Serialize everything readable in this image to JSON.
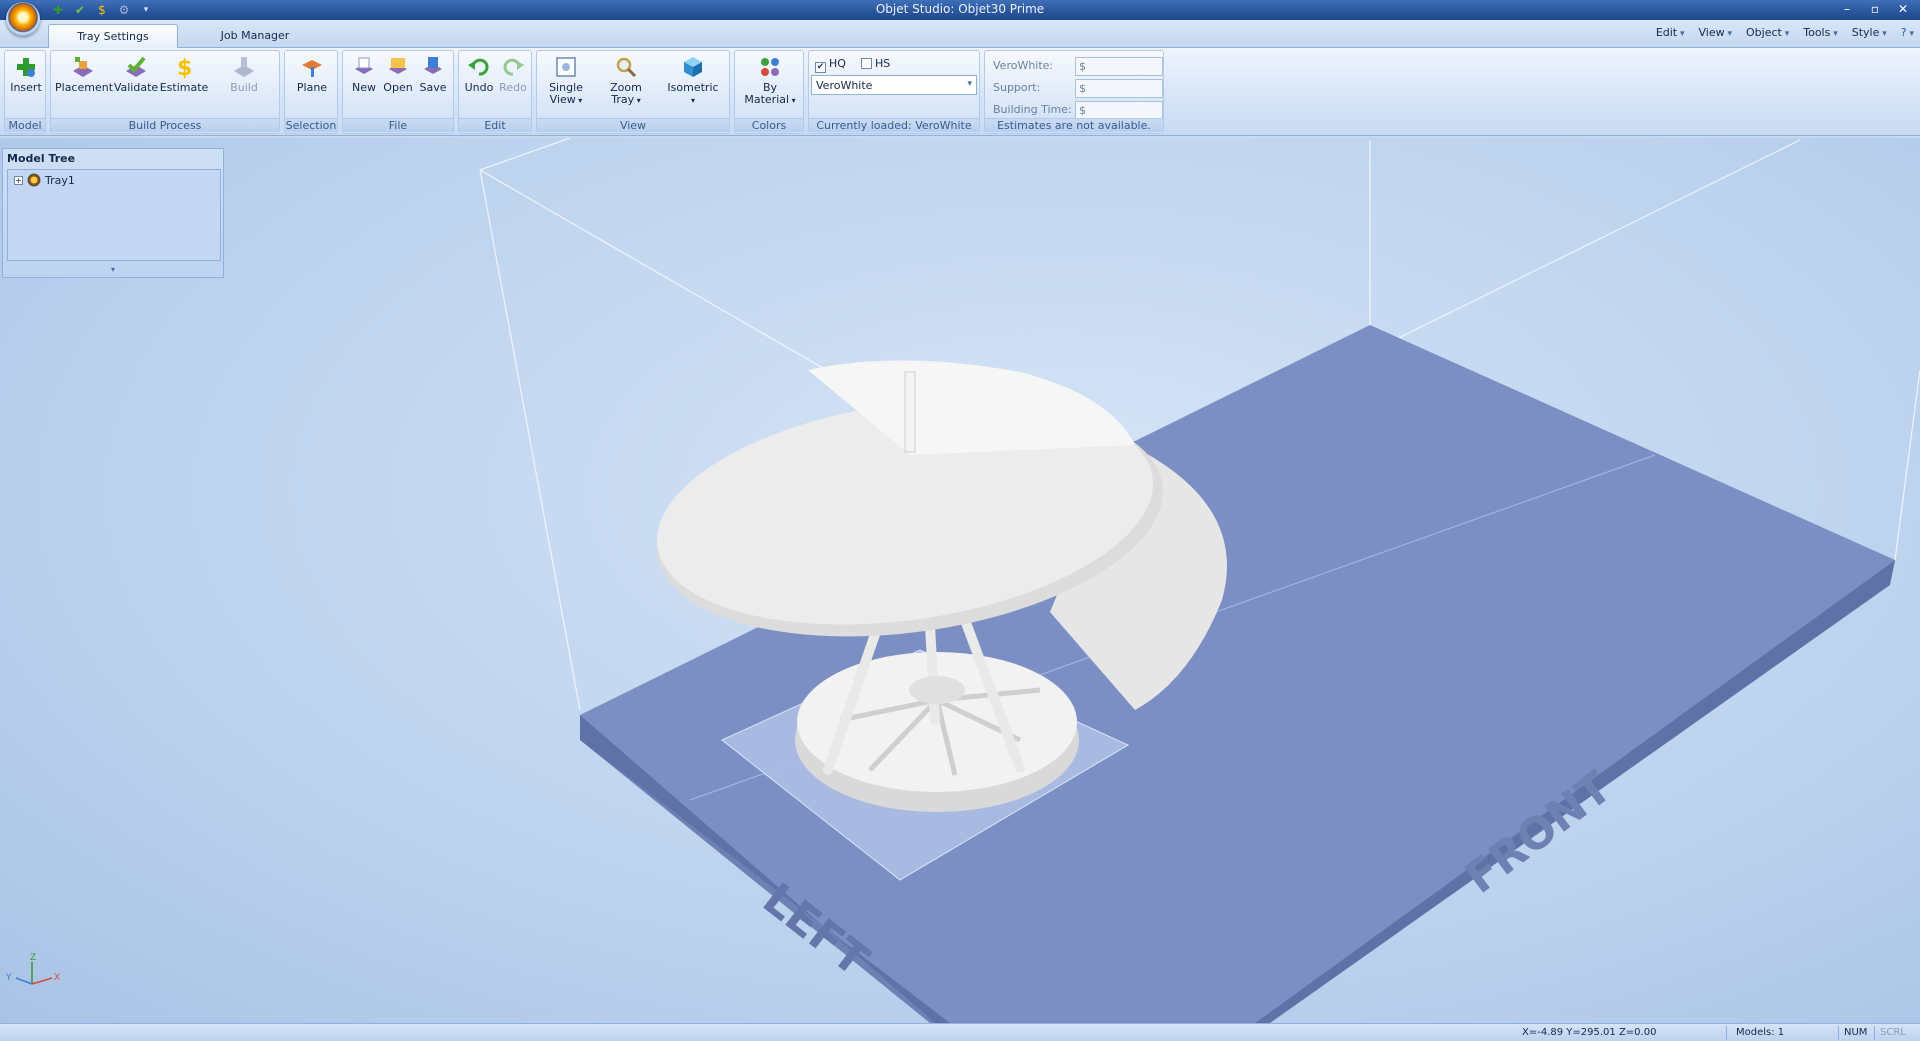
{
  "window": {
    "title": "Objet Studio: Objet30 Prime"
  },
  "tabs": [
    {
      "label": "Tray Settings",
      "active": true
    },
    {
      "label": "Job Manager",
      "active": false
    }
  ],
  "menus": [
    "Edit",
    "View",
    "Object",
    "Tools",
    "Style"
  ],
  "ribbon": {
    "model": {
      "label": "Model",
      "insert": "Insert"
    },
    "build_process": {
      "label": "Build Process",
      "placement": "Placement",
      "validate": "Validate",
      "estimate": "Estimate",
      "build": "Build"
    },
    "selection": {
      "label": "Selection",
      "plane": "Plane"
    },
    "file": {
      "label": "File",
      "new": "New",
      "open": "Open",
      "save": "Save"
    },
    "edit": {
      "label": "Edit",
      "undo": "Undo",
      "redo": "Redo"
    },
    "view": {
      "label": "View",
      "single_view_1": "Single",
      "single_view_2": "View",
      "zoom_tray_1": "Zoom",
      "zoom_tray_2": "Tray",
      "isometric": "Isometric"
    },
    "colors": {
      "label": "Colors",
      "by_material_1": "By",
      "by_material_2": "Material"
    },
    "mode": {
      "hq_label": "HQ",
      "hq_checked": true,
      "hs_label": "HS",
      "hs_checked": false,
      "material_value": "VeroWhite",
      "status": "Currently loaded: VeroWhite"
    },
    "estimates": {
      "rows": [
        {
          "label": "VeroWhite:",
          "value": "$"
        },
        {
          "label": "Support:",
          "value": "$"
        },
        {
          "label": "Building Time:",
          "value": "$"
        }
      ],
      "status": "Estimates are not available."
    }
  },
  "model_tree": {
    "title": "Model Tree",
    "node": "Tray1"
  },
  "tray_labels": {
    "left": "LEFT",
    "front": "FRONT"
  },
  "axes": {
    "x": "X",
    "y": "Y",
    "z": "Z"
  },
  "statusbar": {
    "coords": "X=-4.89 Y=295.01 Z=0.00",
    "models": "Models: 1",
    "num": "NUM",
    "scrl": "SCRL"
  },
  "colors": {
    "tray": "#7f93c6",
    "model": "#e8e8e8",
    "viewport": "#c4d7ef",
    "accent": "#2a559c"
  }
}
